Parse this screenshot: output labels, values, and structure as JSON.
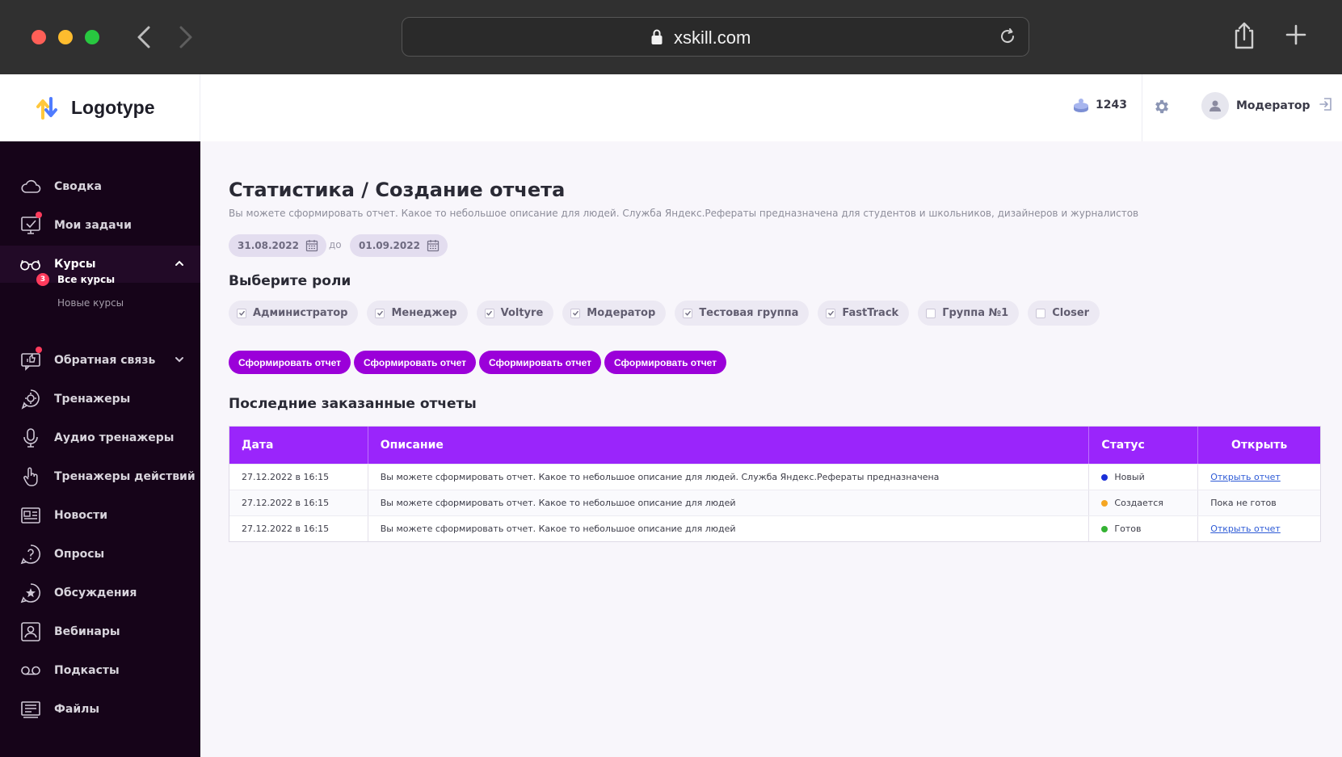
{
  "browser": {
    "url": "xskill.com"
  },
  "header": {
    "logo_text": "Logotype",
    "coins": "1243",
    "user_name": "Модератор"
  },
  "sidebar": {
    "items": [
      {
        "label": "Сводка",
        "icon": "cloud-icon"
      },
      {
        "label": "Мои задачи",
        "icon": "monitor-check-icon",
        "dot": true
      },
      {
        "label": "Курсы",
        "icon": "glasses-icon",
        "active": true
      },
      {
        "label": "Обратная связь",
        "icon": "feedback-icon",
        "dot": true
      },
      {
        "label": "Тренажеры",
        "icon": "trainer-gear-icon"
      },
      {
        "label": "Аудио тренажеры",
        "icon": "microphone-icon"
      },
      {
        "label": "Тренажеры действий",
        "icon": "hand-pointer-icon"
      },
      {
        "label": "Новости",
        "icon": "newspaper-icon"
      },
      {
        "label": "Опросы",
        "icon": "question-icon"
      },
      {
        "label": "Обсуждения",
        "icon": "star-chat-icon"
      },
      {
        "label": "Вебинары",
        "icon": "webinar-icon"
      },
      {
        "label": "Подкасты",
        "icon": "podcast-icon"
      },
      {
        "label": "Файлы",
        "icon": "files-icon"
      }
    ],
    "sub_items": [
      {
        "label": "Все курсы",
        "badge": "3"
      },
      {
        "label": "Новые курсы"
      }
    ]
  },
  "main": {
    "title": "Статистика / Создание отчета",
    "description": "Вы можете сформировать отчет. Какое то небольшое описание для людей. Служба Яндекс.Рефераты предназначена для студентов и школьников, дизайнеров и журналистов",
    "date_from": "31.08.2022",
    "date_to_label": "до",
    "date_to": "01.09.2022",
    "roles_title": "Выберите роли",
    "roles": [
      {
        "label": "Администратор",
        "checked": true
      },
      {
        "label": "Менеджер",
        "checked": true
      },
      {
        "label": "Voltyre",
        "checked": true
      },
      {
        "label": "Модератор",
        "checked": true
      },
      {
        "label": "Тестовая группа",
        "checked": true
      },
      {
        "label": "FastTrack",
        "checked": true
      },
      {
        "label": "Группа №1",
        "checked": false
      },
      {
        "label": "Closer",
        "checked": false
      }
    ],
    "buttons": [
      "Сформировать отчет",
      "Сформировать отчет",
      "Сформировать отчет",
      "Сформировать отчет"
    ],
    "reports_title": "Последние заказанные отчеты",
    "table": {
      "headers": [
        "Дата",
        "Описание",
        "Статус",
        "Открыть"
      ],
      "rows": [
        {
          "date": "27.12.2022 в 16:15",
          "description": "Вы можете сформировать отчет. Какое то небольшое описание для людей. Служба Яндекс.Рефераты предназначена",
          "status": "Новый",
          "status_color": "#1a2fd8",
          "open": "Открыть отчет",
          "is_link": true
        },
        {
          "date": "27.12.2022 в 16:15",
          "description": "Вы можете сформировать отчет. Какое то небольшое описание для людей",
          "status": "Создается",
          "status_color": "#f5a623",
          "open": "Пока не готов",
          "is_link": false
        },
        {
          "date": "27.12.2022 в 16:15",
          "description": "Вы можете сформировать отчет. Какое то небольшое описание для людей",
          "status": "Готов",
          "status_color": "#34b233",
          "open": "Открыть отчет",
          "is_link": true
        }
      ]
    }
  },
  "colors": {
    "accent": "#9b00d9",
    "table_header": "#9a25fb",
    "sidebar_bg": "#160419",
    "main_bg": "#f8f6fb"
  }
}
